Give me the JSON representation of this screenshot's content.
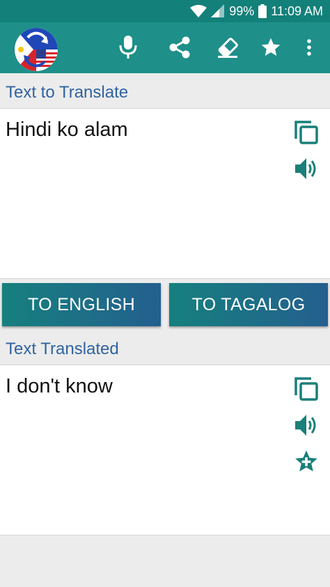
{
  "status_bar": {
    "battery": "99%",
    "time": "11:09 AM",
    "icons": [
      "wifi-icon",
      "signal-icon",
      "battery-icon"
    ]
  },
  "app_bar": {
    "actions": [
      "microphone-icon",
      "share-icon",
      "eraser-icon",
      "star-icon",
      "more-vert-icon"
    ]
  },
  "input_section": {
    "header": "Text to Translate",
    "text": "Hindi ko alam",
    "actions": [
      "copy-icon",
      "speaker-icon"
    ]
  },
  "buttons": {
    "to_english": "TO ENGLISH",
    "to_tagalog": "TO TAGALOG"
  },
  "output_section": {
    "header": "Text Translated",
    "text": "I don't know",
    "actions": [
      "copy-icon",
      "speaker-icon",
      "star-add-icon"
    ]
  },
  "colors": {
    "app_bar": "#1e8f89",
    "status_bar": "#13807a",
    "accent": "#1a7f7a",
    "header_text": "#2f63a0",
    "button_start": "#16807e",
    "button_end": "#245f8f"
  }
}
